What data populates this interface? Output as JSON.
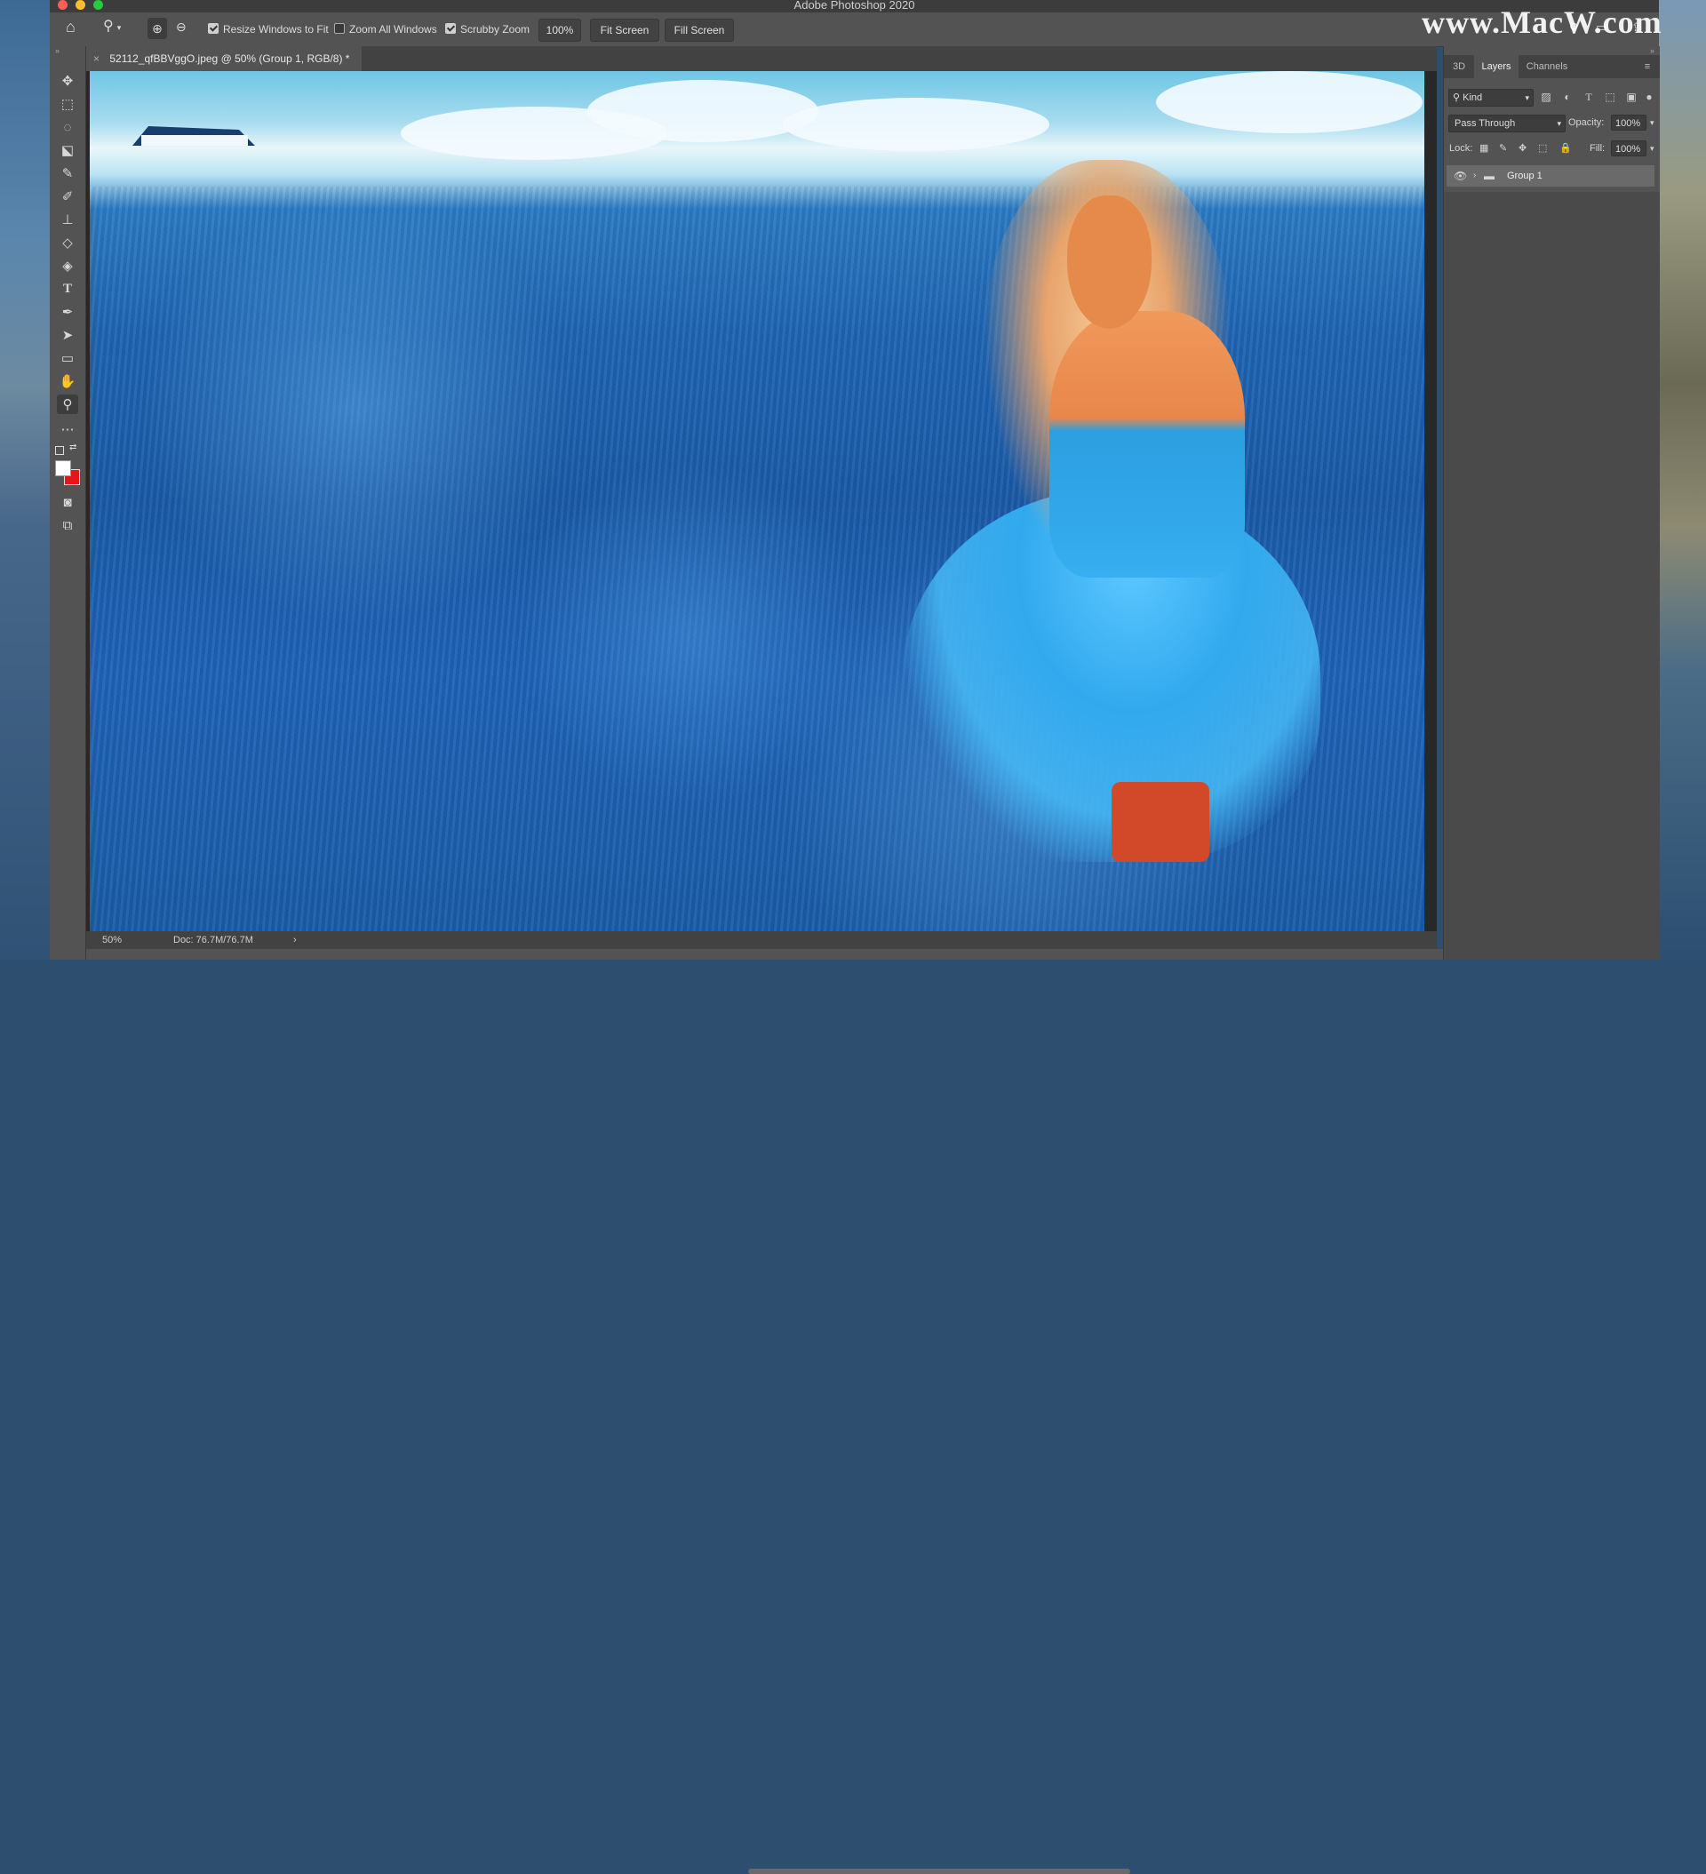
{
  "app": {
    "title": "Adobe Photoshop 2020",
    "watermark": "www.MacW.com"
  },
  "options_bar": {
    "resize_windows_label": "Resize Windows to Fit",
    "resize_windows_checked": true,
    "zoom_all_label": "Zoom All Windows",
    "zoom_all_checked": false,
    "scrubby_zoom_label": "Scrubby Zoom",
    "scrubby_zoom_checked": true,
    "zoom_value": "100%",
    "fit_screen_label": "Fit Screen",
    "fill_screen_label": "Fill Screen"
  },
  "document": {
    "tab_close": "×",
    "tab_title": "52112_qfBBVggO.jpeg @ 50% (Group 1, RGB/8) *"
  },
  "status": {
    "zoom": "50%",
    "doc_info": "Doc: 76.7M/76.7M",
    "arrow": "›"
  },
  "panels": {
    "tabs": [
      {
        "label": "3D",
        "active": false
      },
      {
        "label": "Layers",
        "active": true
      },
      {
        "label": "Channels",
        "active": false
      }
    ],
    "kind_label": "Kind",
    "blend_mode": "Pass Through",
    "opacity_label": "Opacity:",
    "opacity_value": "100%",
    "lock_label": "Lock:",
    "fill_label": "Fill:",
    "fill_value": "100%",
    "layers": [
      {
        "name": "Group 1",
        "type": "group",
        "visible": true
      }
    ]
  },
  "colors": {
    "foreground": "#ffffff",
    "background": "#e8141c",
    "panel_bg": "#535353",
    "dark_bg": "#424242"
  },
  "tools": [
    "move-tool-icon",
    "marquee-tool-icon",
    "lasso-tool-icon",
    "object-select-tool-icon",
    "eyedropper-tool-icon",
    "brush-tool-icon",
    "clone-stamp-tool-icon",
    "eraser-tool-icon",
    "paint-bucket-tool-icon",
    "type-tool-icon",
    "pen-tool-icon",
    "path-select-tool-icon",
    "rectangle-tool-icon",
    "hand-tool-icon",
    "zoom-tool-icon",
    "more-tools-icon"
  ]
}
